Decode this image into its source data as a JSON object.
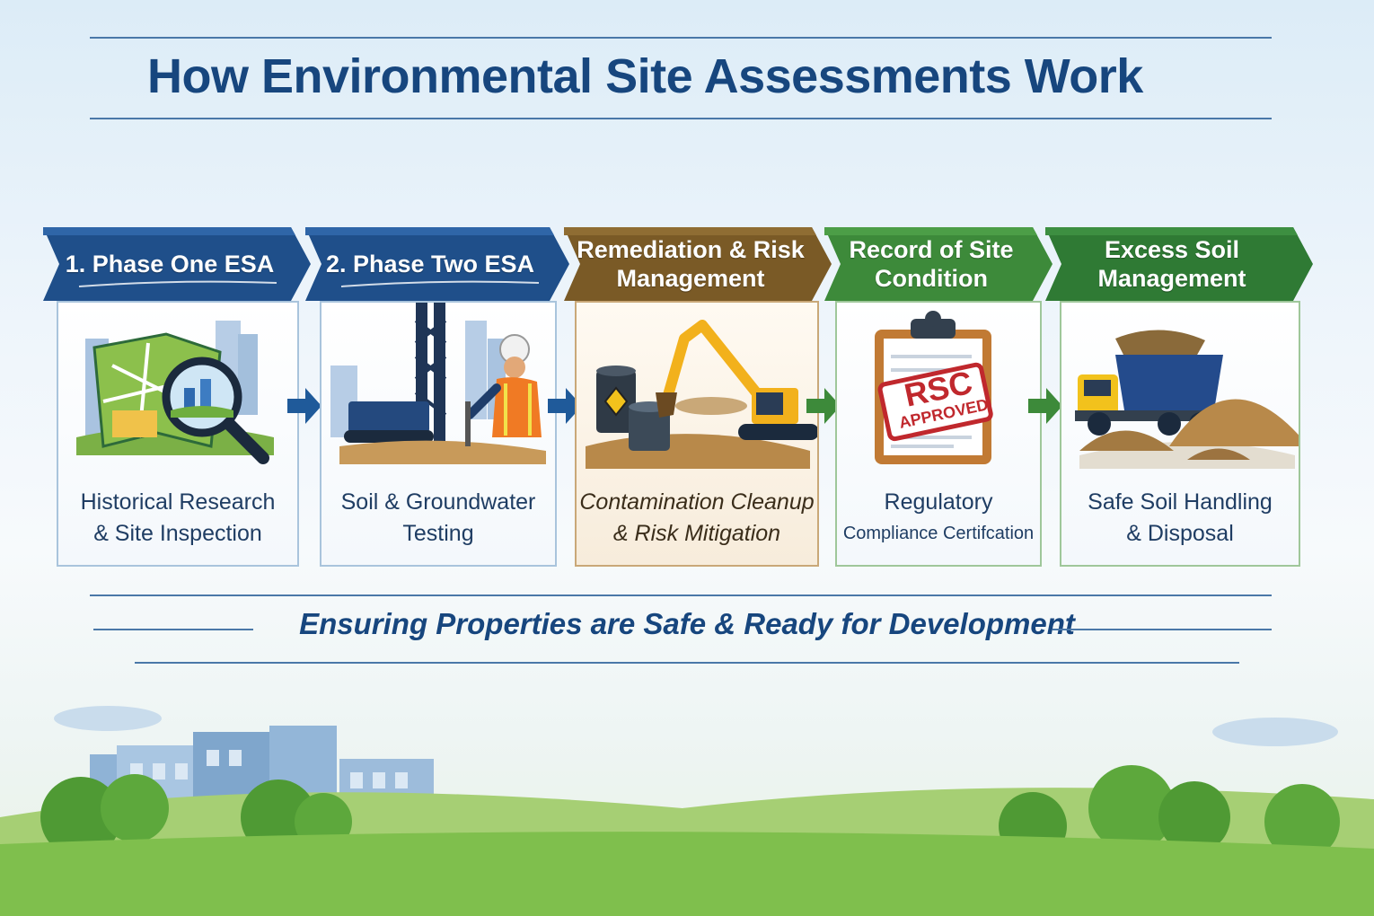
{
  "title": "How Environmental Site Assessments Work",
  "tagline": "Ensuring Properties are Safe & Ready for Development",
  "steps": [
    {
      "label": "1. Phase One ESA",
      "description_line1": "Historical Research",
      "description_line2": "& Site Inspection",
      "color": "#1f4f8a",
      "icon": "map-magnifier-icon"
    },
    {
      "label": "2. Phase Two ESA",
      "description_line1": "Soil & Groundwater",
      "description_line2": "Testing",
      "color": "#1f4f8a",
      "icon": "drill-rig-worker-icon"
    },
    {
      "label_line1": "Remediation & Risk",
      "label_line2": "Management",
      "description_line1": "Contamination Cleanup",
      "description_line2": "& Risk Mitigation",
      "color": "#7a5a26",
      "icon": "excavator-barrels-icon"
    },
    {
      "label_line1": "Record of Site",
      "label_line2": "Condition",
      "description_line1": "Regulatory",
      "description_line2": "Compliance Certifcation",
      "color": "#3d8a3a",
      "icon": "clipboard-rsc-icon",
      "stamp_line1": "RSC",
      "stamp_line2": "APPROVED"
    },
    {
      "label_line1": "Excess Soil",
      "label_line2": "Management",
      "description_line1": "Safe Soil Handling",
      "description_line2": "& Disposal",
      "color": "#2f7a34",
      "icon": "dump-truck-icon"
    }
  ],
  "colors": {
    "title": "#17467e",
    "blue_arrow": "#1f5a9a",
    "green_arrow": "#3d8a3a"
  }
}
